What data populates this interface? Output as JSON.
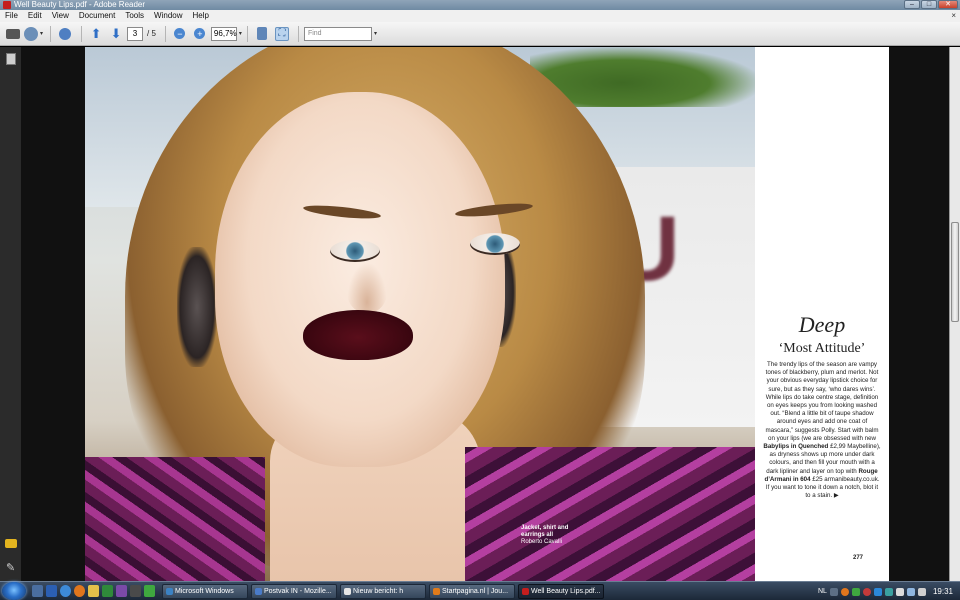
{
  "window": {
    "title": "Well Beauty Lips.pdf - Adobe Reader",
    "minimize_glyph": "–",
    "maximize_glyph": "□",
    "close_glyph": "✕"
  },
  "menu": {
    "items": [
      "File",
      "Edit",
      "View",
      "Document",
      "Tools",
      "Window",
      "Help"
    ],
    "close_glyph": "×"
  },
  "toolbar": {
    "current_page": "3",
    "page_separator": "/ 5",
    "zoom": "96,7%",
    "find_placeholder": "Find"
  },
  "document": {
    "photo_credit_bold": "Jacket, shirt and earrings all",
    "photo_credit_plain": "Roberto Cavalli",
    "sign_text": "TU",
    "heading_italic": "Deep",
    "heading_sub": "‘Most Attitude’",
    "body_1": "The trendy lips of the season are vampy tones of blackberry, plum and merlot. Not your obvious everyday lipstick choice for sure, but as they say, ‘who dares wins’. While lips do take centre stage, definition on eyes keeps you from looking washed out. “Blend a little bit of taupe shadow around eyes and add one coat of mascara,” suggests Polly. Start with balm on your lips (we are obsessed with new",
    "product_1": "Babylips in Quenched",
    "body_2": "£2,99 Maybelline), as dryness shows up more under dark colours, and then fill your mouth with a dark lipliner and layer on top with",
    "product_2": "Rouge d’Armani in 604",
    "body_3": "£25 armanibeauty.co.uk. If you want to tone it down a notch, blot it to a stain.",
    "end_mark": "▶",
    "page_number": "277"
  },
  "taskbar": {
    "tasks": [
      {
        "label": "Microsoft Windows",
        "color": "#3b82c4"
      },
      {
        "label": "Postvak IN - Mozille...",
        "color": "#4a7bc8"
      },
      {
        "label": "Nieuw bericht: h",
        "color": "#e6e6e6"
      },
      {
        "label": "Startpagina.nl | Jou...",
        "color": "#e07b1a"
      },
      {
        "label": "Well Beauty Lips.pdf...",
        "color": "#c41e1e"
      }
    ],
    "language": "NL",
    "clock": "19:31"
  }
}
